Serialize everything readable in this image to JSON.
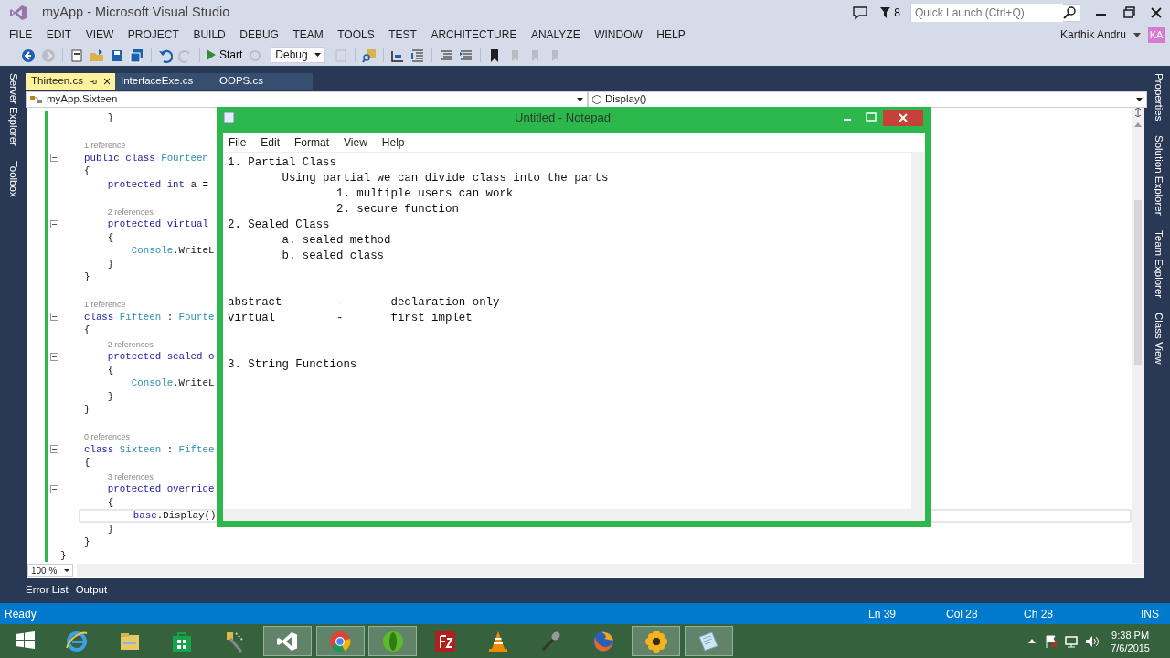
{
  "window": {
    "title": "myApp - Microsoft Visual Studio"
  },
  "title_bar": {
    "notification_count": "8",
    "quick_launch": {
      "placeholder": "Quick Launch (Ctrl+Q)"
    }
  },
  "menu": [
    "FILE",
    "EDIT",
    "VIEW",
    "PROJECT",
    "BUILD",
    "DEBUG",
    "TEAM",
    "TOOLS",
    "TEST",
    "ARCHITECTURE",
    "ANALYZE",
    "WINDOW",
    "HELP"
  ],
  "user": {
    "name": "Karthik Andru",
    "initials": "KA"
  },
  "toolbar": [
    {
      "kind": "back",
      "disabled": false
    },
    {
      "kind": "forward",
      "disabled": true
    },
    {
      "kind": "new-project",
      "disabled": false
    },
    {
      "kind": "open",
      "disabled": false
    },
    {
      "kind": "save",
      "disabled": false
    },
    {
      "kind": "save-all",
      "disabled": false
    },
    {
      "kind": "undo",
      "disabled": false
    },
    {
      "kind": "redo",
      "disabled": true
    },
    {
      "kind": "start",
      "label": "Start",
      "disabled": false
    },
    {
      "kind": "refresh",
      "disabled": true
    },
    {
      "kind": "config",
      "value": "Debug",
      "disabled": false
    },
    {
      "kind": "copy",
      "disabled": true
    },
    {
      "kind": "find",
      "disabled": false
    },
    {
      "kind": "indent",
      "disabled": false
    },
    {
      "kind": "outdent",
      "disabled": false
    },
    {
      "kind": "comment",
      "disabled": false
    },
    {
      "kind": "uncomment",
      "disabled": false
    },
    {
      "kind": "bookmark",
      "disabled": false
    },
    {
      "kind": "bookmark-prev",
      "disabled": true
    },
    {
      "kind": "bookmark-next",
      "disabled": true
    },
    {
      "kind": "bookmark-clear",
      "disabled": true
    }
  ],
  "left_tool_strip": [
    "Server Explorer",
    "Toolbox"
  ],
  "right_tool_strip": [
    "Properties",
    "Solution Explorer",
    "Team Explorer",
    "Class View"
  ],
  "document_tabs": [
    {
      "label": "Thirteen.cs",
      "selected": true
    },
    {
      "label": "InterfaceExe.cs",
      "selected": false
    },
    {
      "label": "OOPS.cs",
      "selected": false
    }
  ],
  "navigation": {
    "type": "myApp.Sixteen",
    "member": "Display()"
  },
  "editor": {
    "lines": [
      {
        "kind": "code",
        "fold": false,
        "current": false,
        "tokens": [
          {
            "text": "        }",
            "kind": "plain"
          }
        ]
      },
      {
        "kind": "blank"
      },
      {
        "kind": "lens",
        "text": "    1 reference"
      },
      {
        "kind": "code",
        "fold": true,
        "current": false,
        "tokens": [
          {
            "text": "    public class ",
            "kind": "keyword"
          },
          {
            "text": "Fourteen",
            "kind": "type"
          }
        ]
      },
      {
        "kind": "code",
        "fold": false,
        "current": false,
        "tokens": [
          {
            "text": "    {",
            "kind": "plain"
          }
        ]
      },
      {
        "kind": "code",
        "fold": false,
        "current": false,
        "tokens": [
          {
            "text": "        protected int",
            "kind": "keyword"
          },
          {
            "text": " a =",
            "kind": "plain"
          }
        ]
      },
      {
        "kind": "blank"
      },
      {
        "kind": "lens",
        "text": "        2 references"
      },
      {
        "kind": "code",
        "fold": true,
        "current": false,
        "tokens": [
          {
            "text": "        protected virtual",
            "kind": "keyword"
          }
        ]
      },
      {
        "kind": "code",
        "fold": false,
        "current": false,
        "tokens": [
          {
            "text": "        {",
            "kind": "plain"
          }
        ]
      },
      {
        "kind": "code",
        "fold": false,
        "current": false,
        "tokens": [
          {
            "text": "            Console",
            "kind": "type"
          },
          {
            "text": ".WriteL",
            "kind": "plain"
          }
        ]
      },
      {
        "kind": "code",
        "fold": false,
        "current": false,
        "tokens": [
          {
            "text": "        }",
            "kind": "plain"
          }
        ]
      },
      {
        "kind": "code",
        "fold": false,
        "current": false,
        "tokens": [
          {
            "text": "    }",
            "kind": "plain"
          }
        ]
      },
      {
        "kind": "blank"
      },
      {
        "kind": "lens",
        "text": "    1 reference"
      },
      {
        "kind": "code",
        "fold": true,
        "current": false,
        "tokens": [
          {
            "text": "    class ",
            "kind": "keyword"
          },
          {
            "text": "Fifteen",
            "kind": "type"
          },
          {
            "text": " : ",
            "kind": "plain"
          },
          {
            "text": "Fourte",
            "kind": "type"
          }
        ]
      },
      {
        "kind": "code",
        "fold": false,
        "current": false,
        "tokens": [
          {
            "text": "    {",
            "kind": "plain"
          }
        ]
      },
      {
        "kind": "lens",
        "text": "        2 references"
      },
      {
        "kind": "code",
        "fold": true,
        "current": false,
        "tokens": [
          {
            "text": "        protected sealed o",
            "kind": "keyword"
          }
        ]
      },
      {
        "kind": "code",
        "fold": false,
        "current": false,
        "tokens": [
          {
            "text": "        {",
            "kind": "plain"
          }
        ]
      },
      {
        "kind": "code",
        "fold": false,
        "current": false,
        "tokens": [
          {
            "text": "            Console",
            "kind": "type"
          },
          {
            "text": ".WriteL",
            "kind": "plain"
          }
        ]
      },
      {
        "kind": "code",
        "fold": false,
        "current": false,
        "tokens": [
          {
            "text": "        }",
            "kind": "plain"
          }
        ]
      },
      {
        "kind": "code",
        "fold": false,
        "current": false,
        "tokens": [
          {
            "text": "    }",
            "kind": "plain"
          }
        ]
      },
      {
        "kind": "blank"
      },
      {
        "kind": "lens",
        "text": "    0 references"
      },
      {
        "kind": "code",
        "fold": true,
        "current": false,
        "tokens": [
          {
            "text": "    class ",
            "kind": "keyword"
          },
          {
            "text": "Sixteen",
            "kind": "type"
          },
          {
            "text": " : ",
            "kind": "plain"
          },
          {
            "text": "Fiftee",
            "kind": "type"
          }
        ]
      },
      {
        "kind": "code",
        "fold": false,
        "current": false,
        "tokens": [
          {
            "text": "    {",
            "kind": "plain"
          }
        ]
      },
      {
        "kind": "lens",
        "text": "        3 references"
      },
      {
        "kind": "code",
        "fold": true,
        "current": false,
        "tokens": [
          {
            "text": "        protected override",
            "kind": "keyword"
          }
        ]
      },
      {
        "kind": "code",
        "fold": false,
        "current": false,
        "tokens": [
          {
            "text": "        {",
            "kind": "plain"
          }
        ]
      },
      {
        "kind": "code",
        "fold": false,
        "current": true,
        "tokens": [
          {
            "text": "            base",
            "kind": "keyword"
          },
          {
            "text": ".Display()",
            "kind": "plain"
          }
        ]
      },
      {
        "kind": "code",
        "fold": false,
        "current": false,
        "tokens": [
          {
            "text": "        }",
            "kind": "plain"
          }
        ]
      },
      {
        "kind": "code",
        "fold": false,
        "current": false,
        "tokens": [
          {
            "text": "    }",
            "kind": "plain"
          }
        ]
      },
      {
        "kind": "code",
        "fold": false,
        "current": false,
        "tokens": [
          {
            "text": "}",
            "kind": "plain"
          }
        ]
      }
    ],
    "zoom": "100 %"
  },
  "tool_tabs": [
    "Error List",
    "Output"
  ],
  "status_bar": {
    "text": "Ready",
    "line": "Ln 39",
    "column": "Col 28",
    "char": "Ch 28",
    "mode": "INS"
  },
  "notepad": {
    "title": "Untitled - Notepad",
    "menu": [
      "File",
      "Edit",
      "Format",
      "View",
      "Help"
    ],
    "text": "1. Partial Class\n\tUsing partial we can divide class into the parts\n\t\t1. multiple users can work\n\t\t2. secure function\n2. Sealed Class\n\ta. sealed method\n\tb. sealed class\n\n\nabstract\t-\tdeclaration only\nvirtual\t\t-\tfirst implet\n\n\n3. String Functions"
  },
  "taskbar": {
    "apps": [
      {
        "kind": "start",
        "active": false
      },
      {
        "kind": "browser-e",
        "active": false
      },
      {
        "kind": "folder",
        "active": false
      },
      {
        "kind": "store",
        "active": false
      },
      {
        "kind": "tools",
        "active": false
      },
      {
        "kind": "vs",
        "active": true
      },
      {
        "kind": "chrome",
        "active": true
      },
      {
        "kind": "green-orb",
        "active": true
      },
      {
        "kind": "ftp",
        "active": false
      },
      {
        "kind": "cone",
        "active": false
      },
      {
        "kind": "microphone",
        "active": false
      },
      {
        "kind": "firefox",
        "active": false
      },
      {
        "kind": "flower",
        "active": true
      },
      {
        "kind": "notepad",
        "active": true
      }
    ],
    "clock": {
      "time": "9:38 PM",
      "date": "7/6/2015"
    }
  }
}
